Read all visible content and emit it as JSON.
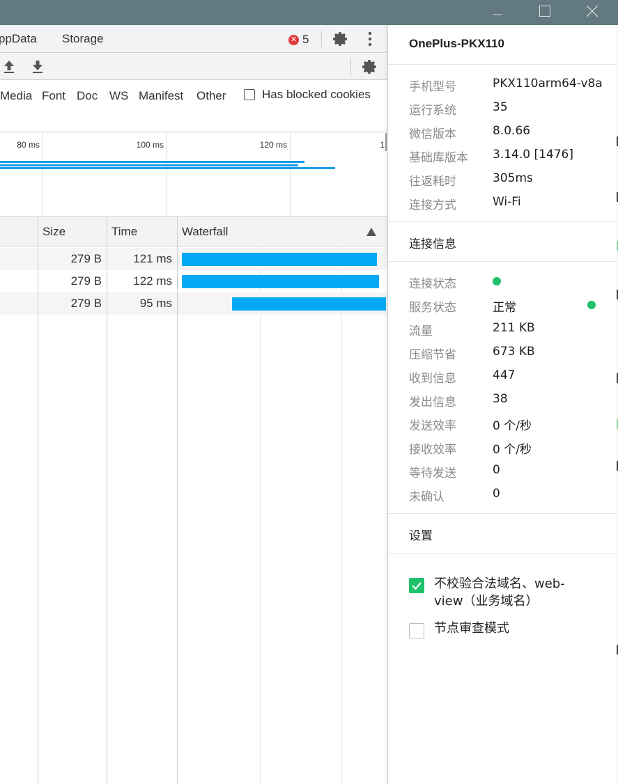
{
  "devtools": {
    "tabs": [
      "ppData",
      "Storage"
    ],
    "error_count": "5",
    "filter_types": [
      "Media",
      "Font",
      "Doc",
      "WS",
      "Manifest",
      "Other"
    ],
    "has_blocked_cookies_label": "Has blocked cookies",
    "overview_labels": [
      "80 ms",
      "100 ms",
      "120 ms",
      "1"
    ],
    "columns": {
      "size": "Size",
      "time": "Time",
      "waterfall": "Waterfall"
    },
    "rows": [
      {
        "size": "279 B",
        "time": "121 ms"
      },
      {
        "size": "279 B",
        "time": "122 ms"
      },
      {
        "size": "279 B",
        "time": "95 ms"
      }
    ]
  },
  "panel": {
    "title": "OnePlus-PKX110",
    "device_info": [
      {
        "key": "手机型号",
        "value": "PKX110arm64-v8a"
      },
      {
        "key": "运行系统",
        "value": "35"
      },
      {
        "key": "微信版本",
        "value": "8.0.66"
      },
      {
        "key": "基础库版本",
        "value": "3.14.0 [1476]"
      },
      {
        "key": "往返耗时",
        "value": "305ms"
      },
      {
        "key": "连接方式",
        "value": "Wi-Fi"
      }
    ],
    "connection_title": "连接信息",
    "connection_info": [
      {
        "key": "连接状态",
        "value": ""
      },
      {
        "key": "服务状态",
        "value": "正常"
      },
      {
        "key": "流量",
        "value": "211 KB"
      },
      {
        "key": "压缩节省",
        "value": "673 KB"
      },
      {
        "key": "收到信息",
        "value": "447"
      },
      {
        "key": "发出信息",
        "value": "38"
      },
      {
        "key": "发送效率",
        "value": "0 个/秒"
      },
      {
        "key": "接收效率",
        "value": "0 个/秒"
      },
      {
        "key": "等待发送",
        "value": "0"
      },
      {
        "key": "未确认",
        "value": "0"
      }
    ],
    "settings_title": "设置",
    "settings": [
      {
        "label": "不校验合法域名、web-view（业务域名）",
        "checked": true
      },
      {
        "label": "节点审查模式",
        "checked": false
      }
    ]
  },
  "colors": {
    "titlebar": "#62797f",
    "accent_green": "#1fc26a",
    "waterfall_blue": "#03a9f4",
    "error_red": "#e23b3b"
  }
}
